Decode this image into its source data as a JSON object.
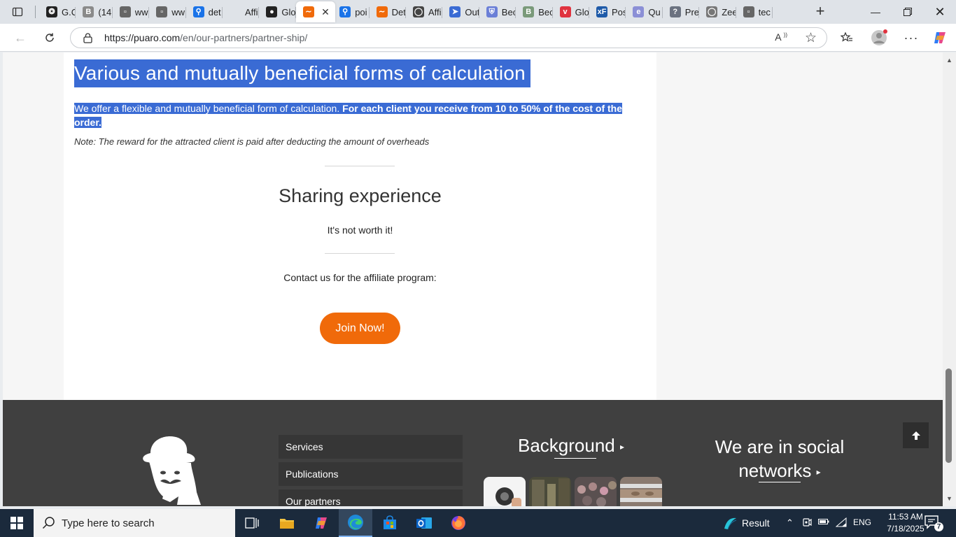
{
  "browser": {
    "tabs": [
      {
        "title": "G.C",
        "icon": "openai-icon",
        "color": "#222222"
      },
      {
        "title": "(14",
        "icon": "b-icon",
        "color": "#8a8a8a"
      },
      {
        "title": "ww",
        "icon": "ghost-icon",
        "color": "#666666"
      },
      {
        "title": "ww",
        "icon": "ghost-icon",
        "color": "#666666"
      },
      {
        "title": "det",
        "icon": "search-icon",
        "color": "#1a73e8"
      },
      {
        "title": "Affi",
        "icon": "blank-icon",
        "color": "#dfe3e8"
      },
      {
        "title": "Glo",
        "icon": "people-icon",
        "color": "#222222"
      },
      {
        "title": "",
        "icon": "mustache-icon",
        "color": "#f06a0a",
        "active": true
      },
      {
        "title": "poi",
        "icon": "search-icon",
        "color": "#1a73e8"
      },
      {
        "title": "Det",
        "icon": "mustache-icon",
        "color": "#f06a0a"
      },
      {
        "title": "Affi",
        "icon": "globe-icon",
        "color": "#444444"
      },
      {
        "title": "Out",
        "icon": "arrow-icon",
        "color": "#3a6bd4"
      },
      {
        "title": "Bec",
        "icon": "shield-icon",
        "color": "#6b7fd7"
      },
      {
        "title": "Bec",
        "icon": "b-icon",
        "color": "#7a9a7a"
      },
      {
        "title": "Glo",
        "icon": "pocket-icon",
        "color": "#e0333f"
      },
      {
        "title": "Pos",
        "icon": "xf-icon",
        "color": "#1e5aa8"
      },
      {
        "title": "Qu",
        "icon": "e-icon",
        "color": "#8b8fd6"
      },
      {
        "title": "Pre",
        "icon": "question-icon",
        "color": "#6b7280"
      },
      {
        "title": "Zee",
        "icon": "globe-icon",
        "color": "#777777"
      },
      {
        "title": "tec",
        "icon": "ghost-icon",
        "color": "#666666"
      }
    ],
    "url_host": "https://puaro.com",
    "url_path": "/en/our-partners/partner-ship/"
  },
  "page": {
    "calc_heading": "Various and mutually beneficial forms of calculation",
    "calc_text_plain": "We offer a flexible and mutually beneficial form of calculation.",
    "calc_text_bold": "For each client you receive from 10 to 50% of the cost of the order.",
    "note": "Note: The reward for the attracted client is paid after deducting the amount of overheads",
    "share_heading": "Sharing experience",
    "share_text": "It's not worth it!",
    "contact_text": "Contact us for the affiliate program:",
    "join_label": "Join Now!"
  },
  "footer": {
    "menu": [
      "Services",
      "Publications",
      "Our partners"
    ],
    "background_title": "Background",
    "social_title_1": "We are in social",
    "social_title_2": "networks"
  },
  "taskbar": {
    "search_placeholder": "Type here to search",
    "weather": "Result",
    "lang": "ENG",
    "time": "11:53 AM",
    "date": "7/18/2025",
    "notif_count": "7"
  },
  "colors": {
    "accent": "#f06a0a",
    "selection": "#3a6bd4",
    "footer_bg": "#404040"
  }
}
